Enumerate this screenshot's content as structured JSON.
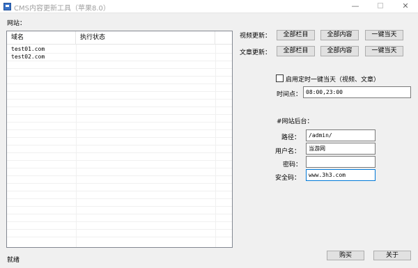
{
  "window": {
    "title": "CMS内容更新工具（苹果8.0）",
    "min_glyph": "—",
    "close_glyph": "✕"
  },
  "site_list": {
    "label": "网站：",
    "columns": [
      "域名",
      "执行状态"
    ],
    "rows": [
      {
        "domain": "test01.com",
        "status": ""
      },
      {
        "domain": "test02.com",
        "status": ""
      }
    ]
  },
  "video_update": {
    "label": "视频更新：",
    "buttons": [
      "全部栏目",
      "全部内容",
      "一键当天"
    ]
  },
  "article_update": {
    "label": "文章更新：",
    "buttons": [
      "全部栏目",
      "全部内容",
      "一键当天"
    ]
  },
  "schedule": {
    "checkbox_label": "启用定时一键当天（视频、文章）",
    "checked": false,
    "time_label": "时间点：",
    "time_value": "08:00,23:00"
  },
  "backend": {
    "heading": "#网站后台：",
    "path_label": "路径：",
    "path_value": "/admin/",
    "username_label": "用户名：",
    "username_value": "当游网",
    "password_label": "密码：",
    "password_value": "",
    "security_label": "安全码：",
    "security_value": "www.3h3.com"
  },
  "footer": {
    "buy_label": "购买",
    "about_label": "关于",
    "status": "就绪"
  }
}
